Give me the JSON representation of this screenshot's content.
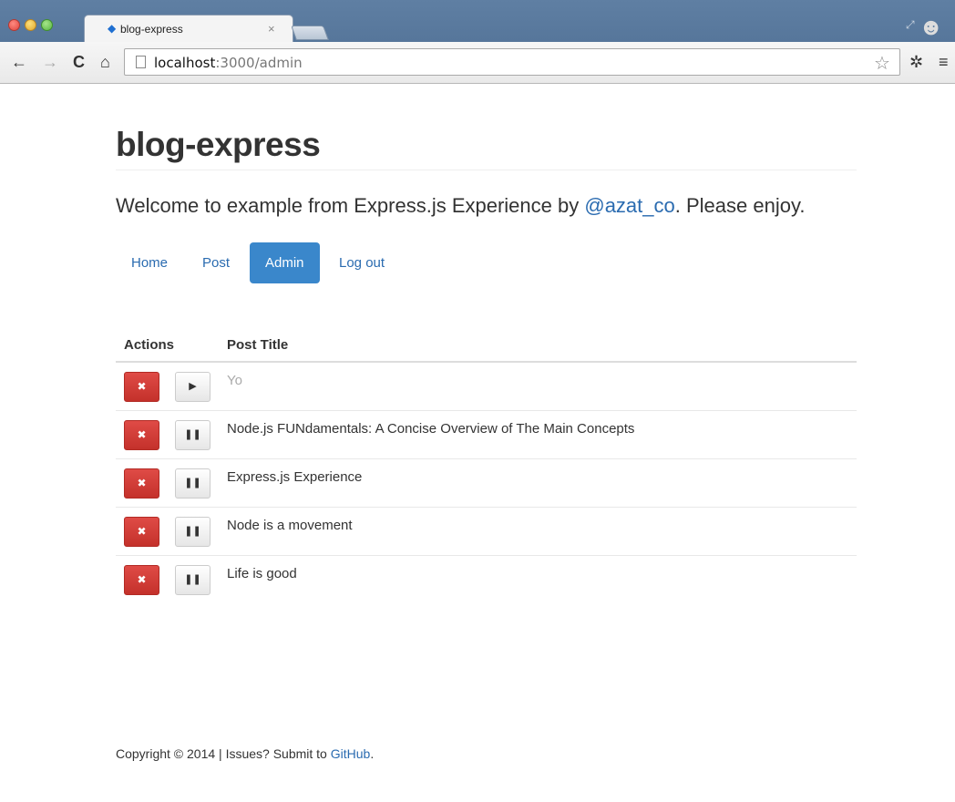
{
  "browser": {
    "tab_title": "blog-express",
    "tab_close": "×",
    "url_host": "localhost",
    "url_rest": ":3000/admin",
    "back_icon": "←",
    "forward_icon": "→",
    "reload_icon": "C",
    "home_icon": "⌂",
    "star_icon": "☆",
    "gear_icon": "✲",
    "menu_icon": "≡"
  },
  "page": {
    "site_title": "blog-express",
    "lead_before": "Welcome to example from Express.js Experience by ",
    "lead_link": "@azat_co",
    "lead_after": ". Please enjoy."
  },
  "nav": {
    "items": [
      {
        "label": "Home"
      },
      {
        "label": "Post"
      },
      {
        "label": "Admin",
        "active": true
      },
      {
        "label": "Log out"
      }
    ]
  },
  "table": {
    "headers": {
      "actions": "Actions",
      "title": "Post Title"
    },
    "delete_icon": "✖",
    "rows": [
      {
        "title": "Yo",
        "published": false,
        "toggle_icon": "▶"
      },
      {
        "title": "Node.js FUNdamentals: A Concise Overview of The Main Concepts",
        "published": true,
        "toggle_icon": "❚❚"
      },
      {
        "title": "Express.js Experience",
        "published": true,
        "toggle_icon": "❚❚"
      },
      {
        "title": "Node is a movement",
        "published": true,
        "toggle_icon": "❚❚"
      },
      {
        "title": "Life is good",
        "published": true,
        "toggle_icon": "❚❚"
      }
    ]
  },
  "footer": {
    "text": "Copyright © 2014 | Issues? Submit to ",
    "link": "GitHub",
    "after": "."
  },
  "colors": {
    "accent": "#3a87cb",
    "link": "#2a6bb0",
    "danger": "#c4312b"
  }
}
